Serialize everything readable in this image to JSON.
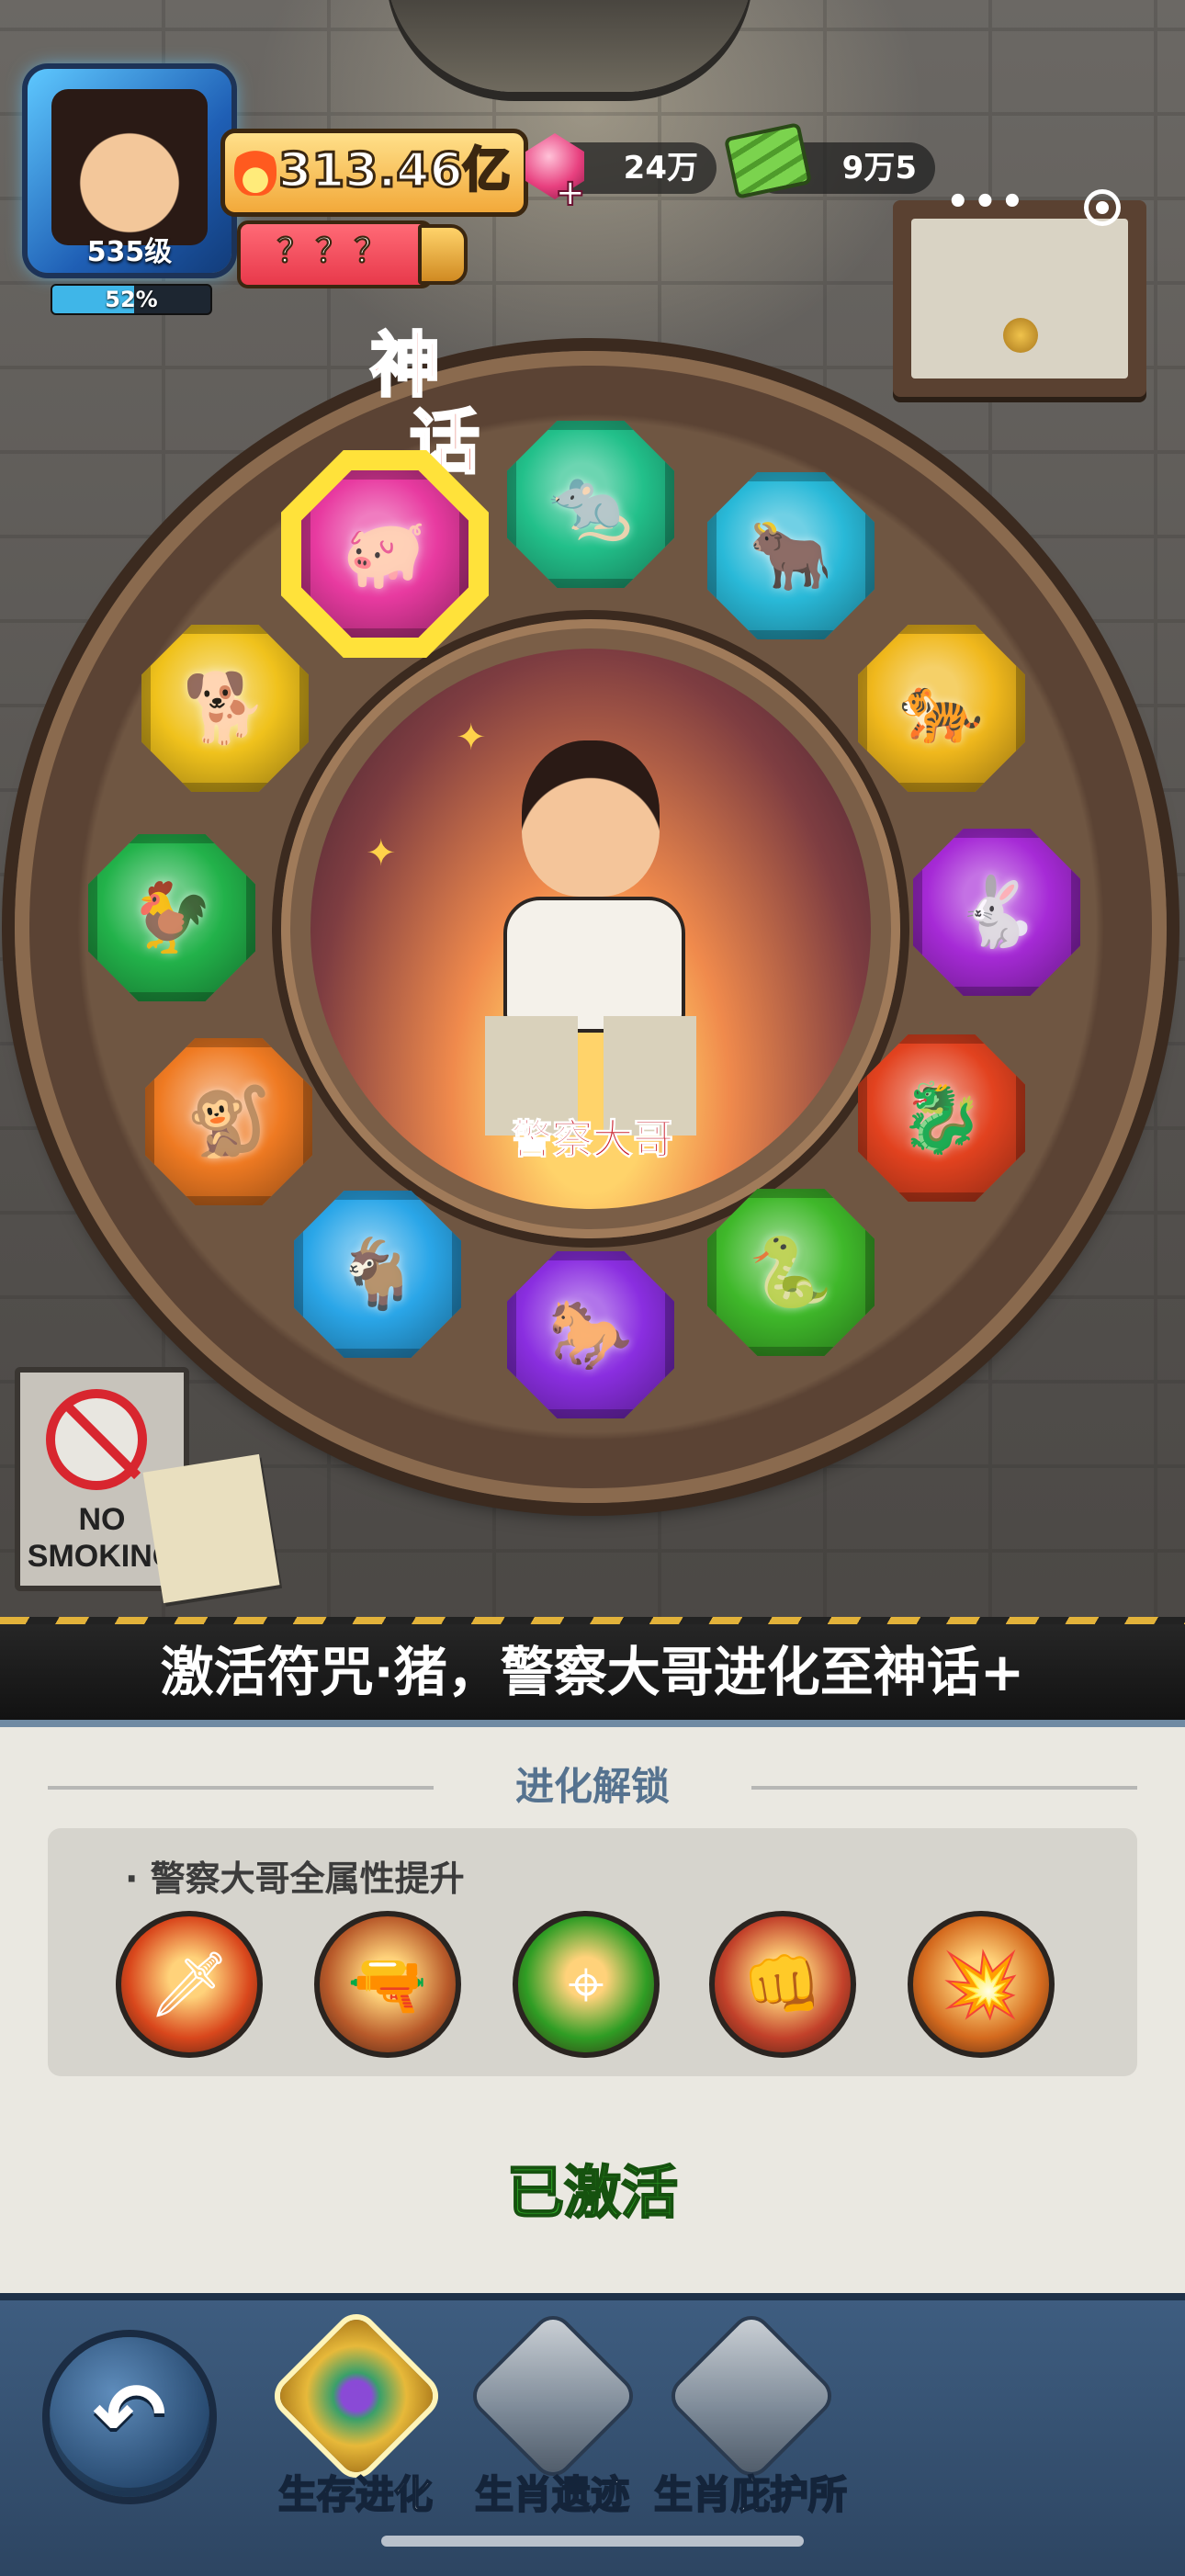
{
  "hud": {
    "avatar_level": "535级",
    "xp_percent_text": "52%",
    "xp_fraction": 0.52,
    "power": "313.46亿",
    "player_name": "？？？",
    "gems": "24万",
    "cash": "9万5",
    "more_label": "•••"
  },
  "scene_sign": {
    "line1": "NO",
    "line2": "SMOKING"
  },
  "wheel": {
    "hero_rank_line1": "神",
    "hero_rank_line2": "话+",
    "hero_name": "警察大哥",
    "selected_zodiac": "pig",
    "zodiac": [
      {
        "id": "pig",
        "icon": "pig-icon",
        "glyph": "🐖",
        "color": "#e83aa0"
      },
      {
        "id": "rat",
        "icon": "rat-icon",
        "glyph": "🐀",
        "color": "#22c08a"
      },
      {
        "id": "ox",
        "icon": "ox-icon",
        "glyph": "🐂",
        "color": "#29b9d8"
      },
      {
        "id": "tiger",
        "icon": "tiger-icon",
        "glyph": "🐅",
        "color": "#f0b81c"
      },
      {
        "id": "rabbit",
        "icon": "rabbit-icon",
        "glyph": "🐇",
        "color": "#a62ad6"
      },
      {
        "id": "dragon",
        "icon": "dragon-icon",
        "glyph": "🐉",
        "color": "#e2421f"
      },
      {
        "id": "snake",
        "icon": "snake-icon",
        "glyph": "🐍",
        "color": "#3fb82a"
      },
      {
        "id": "horse",
        "icon": "horse-icon",
        "glyph": "🐎",
        "color": "#8a2ee0"
      },
      {
        "id": "goat",
        "icon": "goat-icon",
        "glyph": "🐐",
        "color": "#2aa6e8"
      },
      {
        "id": "monkey",
        "icon": "monkey-icon",
        "glyph": "🐒",
        "color": "#ef7a22"
      },
      {
        "id": "rooster",
        "icon": "rooster-icon",
        "glyph": "🐓",
        "color": "#22b24a"
      },
      {
        "id": "dog",
        "icon": "dog-icon",
        "glyph": "🐕",
        "color": "#f0c21c"
      }
    ]
  },
  "banner": {
    "message": "激活符咒·猪，警察大哥进化至神话+"
  },
  "panel": {
    "title": "进化解锁",
    "skill_heading": "· 警察大哥全属性提升",
    "skills": [
      {
        "icon": "flaming-sword-icon",
        "glyph": "🗡",
        "color": "#d9471c"
      },
      {
        "icon": "hero-shooting-icon",
        "glyph": "🔫",
        "color": "#b85a2a"
      },
      {
        "icon": "crosshair-target-icon",
        "glyph": "⌖",
        "color": "#2f9d24"
      },
      {
        "icon": "hero-fist-icon",
        "glyph": "👊",
        "color": "#c2412a"
      },
      {
        "icon": "hero-rifle-icon",
        "glyph": "💥",
        "color": "#d46a1e"
      }
    ],
    "status": "已激活"
  },
  "nav": {
    "back_label": "↶",
    "tabs": [
      {
        "label": "生存进化",
        "icon": "zodiac-wheel-icon",
        "active": true
      },
      {
        "label": "生肖遗迹",
        "icon": "ruins-building-icon",
        "active": false
      },
      {
        "label": "生肖庇护所",
        "icon": "shelter-building-icon",
        "active": false
      }
    ]
  }
}
